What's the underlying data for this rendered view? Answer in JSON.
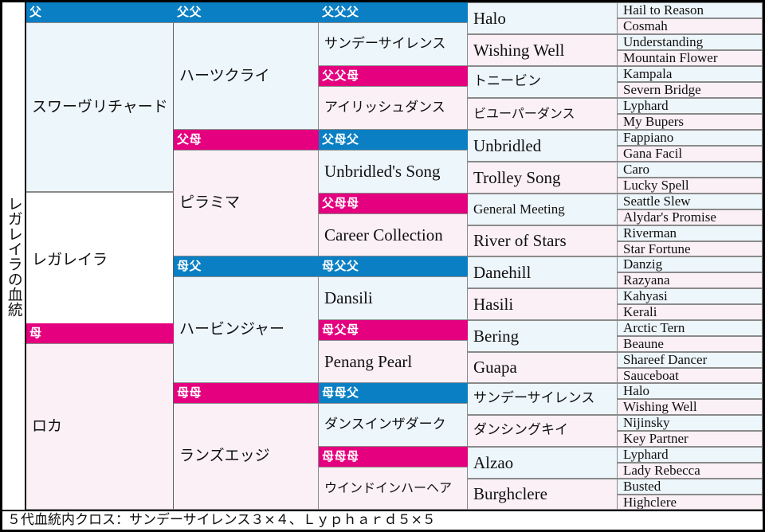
{
  "side_label": {
    "text": "レガレイラの血統"
  },
  "generation_labels": {
    "sire": "父",
    "dam": "母",
    "sire_sire": "父父",
    "sire_dam": "父母",
    "dam_sire": "母父",
    "dam_dam": "母母",
    "sire_sire_sire": "父父父",
    "sire_sire_dam": "父父母",
    "sire_dam_sire": "父母父",
    "sire_dam_dam": "父母母",
    "dam_sire_sire": "母父父",
    "dam_sire_dam": "母父母",
    "dam_dam_sire": "母母父",
    "dam_dam_dam": "母母母"
  },
  "colors": {
    "sire_header": "#0b7fc4",
    "dam_header": "#e4007e",
    "sire_tint": "#edf6fb",
    "dam_tint": "#fbf0f6",
    "self_tint": "#ffffff",
    "grid_line": "#8a8a8a",
    "outer_border": "#000000"
  },
  "generation1": [
    {
      "name": "スワーヴリチャード",
      "line": "sire"
    },
    {
      "name": "レガレイラ",
      "line": "self"
    },
    {
      "name": "ロカ",
      "line": "dam"
    }
  ],
  "generation2": [
    {
      "name": "ハーツクライ",
      "line": "sire"
    },
    {
      "name": "ピラミマ",
      "line": "dam"
    },
    {
      "name": "ハービンジャー",
      "line": "sire"
    },
    {
      "name": "ランズエッジ",
      "line": "dam"
    }
  ],
  "generation3": [
    {
      "name": "サンデーサイレンス",
      "line": "sire"
    },
    {
      "name": "アイリッシュダンス",
      "line": "dam"
    },
    {
      "name": "Unbridled's Song",
      "line": "sire"
    },
    {
      "name": "Career Collection",
      "line": "dam"
    },
    {
      "name": "Dansili",
      "line": "sire"
    },
    {
      "name": "Penang Pearl",
      "line": "dam"
    },
    {
      "name": "ダンスインザダーク",
      "line": "sire"
    },
    {
      "name": "ウインドインハーヘア",
      "line": "dam"
    }
  ],
  "generation4": [
    {
      "name": "Halo",
      "line": "sire"
    },
    {
      "name": "Wishing Well",
      "line": "dam"
    },
    {
      "name": "トニービン",
      "line": "sire"
    },
    {
      "name": "ビユーパーダンス",
      "line": "dam"
    },
    {
      "name": "Unbridled",
      "line": "sire"
    },
    {
      "name": "Trolley Song",
      "line": "dam"
    },
    {
      "name": "General Meeting",
      "line": "sire"
    },
    {
      "name": "River of Stars",
      "line": "dam"
    },
    {
      "name": "Danehill",
      "line": "sire"
    },
    {
      "name": "Hasili",
      "line": "dam"
    },
    {
      "name": "Bering",
      "line": "sire"
    },
    {
      "name": "Guapa",
      "line": "dam"
    },
    {
      "name": "サンデーサイレンス",
      "line": "sire"
    },
    {
      "name": "ダンシングキイ",
      "line": "dam"
    },
    {
      "name": "Alzao",
      "line": "sire"
    },
    {
      "name": "Burghclere",
      "line": "dam"
    }
  ],
  "generation5": [
    {
      "name": "Hail to Reason",
      "line": "sire"
    },
    {
      "name": "Cosmah",
      "line": "dam"
    },
    {
      "name": "Understanding",
      "line": "sire"
    },
    {
      "name": "Mountain Flower",
      "line": "dam"
    },
    {
      "name": "Kampala",
      "line": "sire"
    },
    {
      "name": "Severn Bridge",
      "line": "dam"
    },
    {
      "name": "Lyphard",
      "line": "sire"
    },
    {
      "name": "My Bupers",
      "line": "dam"
    },
    {
      "name": "Fappiano",
      "line": "sire"
    },
    {
      "name": "Gana Facil",
      "line": "dam"
    },
    {
      "name": "Caro",
      "line": "sire"
    },
    {
      "name": "Lucky Spell",
      "line": "dam"
    },
    {
      "name": "Seattle Slew",
      "line": "sire"
    },
    {
      "name": "Alydar's Promise",
      "line": "dam"
    },
    {
      "name": "Riverman",
      "line": "sire"
    },
    {
      "name": "Star Fortune",
      "line": "dam"
    },
    {
      "name": "Danzig",
      "line": "sire"
    },
    {
      "name": "Razyana",
      "line": "dam"
    },
    {
      "name": "Kahyasi",
      "line": "sire"
    },
    {
      "name": "Kerali",
      "line": "dam"
    },
    {
      "name": "Arctic Tern",
      "line": "sire"
    },
    {
      "name": "Beaune",
      "line": "dam"
    },
    {
      "name": "Shareef Dancer",
      "line": "sire"
    },
    {
      "name": "Sauceboat",
      "line": "dam"
    },
    {
      "name": "Halo",
      "line": "sire"
    },
    {
      "name": "Wishing Well",
      "line": "dam"
    },
    {
      "name": "Nijinsky",
      "line": "sire"
    },
    {
      "name": "Key Partner",
      "line": "dam"
    },
    {
      "name": "Lyphard",
      "line": "sire"
    },
    {
      "name": "Lady Rebecca",
      "line": "dam"
    },
    {
      "name": "Busted",
      "line": "sire"
    },
    {
      "name": "Highclere",
      "line": "dam"
    }
  ],
  "footer": {
    "text": "５代血統内クロス：サンデーサイレンス３×４、Ｌｙｐｈａｒｄ５×５"
  }
}
